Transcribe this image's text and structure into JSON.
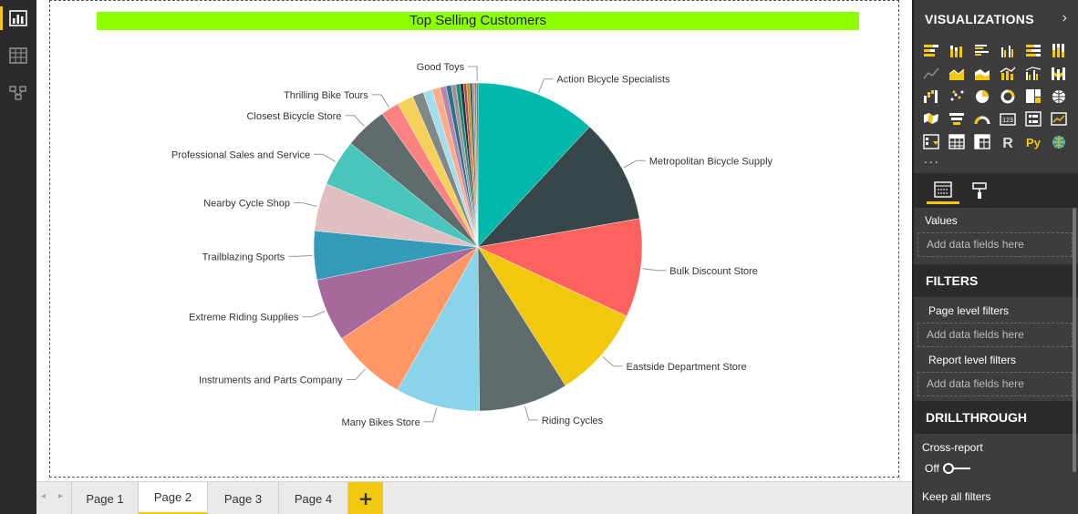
{
  "rail": {
    "items": [
      {
        "name": "report-view",
        "icon": "bar-chart-icon",
        "active": true
      },
      {
        "name": "data-view",
        "icon": "table-grid-icon",
        "active": false
      },
      {
        "name": "model-view",
        "icon": "relationships-icon",
        "active": false
      }
    ]
  },
  "visual": {
    "title": "Top Selling Customers",
    "title_bg": "#8cff00"
  },
  "chart_data": {
    "type": "pie",
    "title": "Top Selling Customers",
    "legend": "none (data labels on slices)",
    "slices": [
      {
        "label": "Action Bicycle Specialists",
        "value": 11.9,
        "color": "#01b8aa"
      },
      {
        "label": "Metropolitan Bicycle Supply",
        "value": 10.3,
        "color": "#374649"
      },
      {
        "label": "Bulk Discount Store",
        "value": 9.7,
        "color": "#fd625e"
      },
      {
        "label": "Eastside Department Store",
        "value": 9.1,
        "color": "#f2c80f"
      },
      {
        "label": "Riding Cycles",
        "value": 8.8,
        "color": "#5f6b6d"
      },
      {
        "label": "Many Bikes Store",
        "value": 8.3,
        "color": "#8ad4eb"
      },
      {
        "label": "Instruments and Parts Company",
        "value": 7.4,
        "color": "#fe9666"
      },
      {
        "label": "Extreme Riding Supplies",
        "value": 6.2,
        "color": "#a66999"
      },
      {
        "label": "Trailblazing Sports",
        "value": 4.8,
        "color": "#3599b8"
      },
      {
        "label": "Nearby Cycle Shop",
        "value": 4.7,
        "color": "#dfbfbf"
      },
      {
        "label": "Professional Sales and Service",
        "value": 4.6,
        "color": "#4ac5bb"
      },
      {
        "label": "Closest Bicycle Store",
        "value": 4.2,
        "color": "#5f6b6d"
      },
      {
        "label": "Thrilling Bike Tours",
        "value": 1.8,
        "color": "#fb8281"
      },
      {
        "label": "",
        "value": 1.6,
        "color": "#f4d25a"
      },
      {
        "label": "",
        "value": 1.1,
        "color": "#7f898a"
      },
      {
        "label": "",
        "value": 0.9,
        "color": "#a4ddee"
      },
      {
        "label": "",
        "value": 0.8,
        "color": "#fdab89"
      },
      {
        "label": "",
        "value": 0.6,
        "color": "#b687ac"
      },
      {
        "label": "",
        "value": 0.5,
        "color": "#28738a"
      },
      {
        "label": "",
        "value": 0.45,
        "color": "#a78f8f"
      },
      {
        "label": "",
        "value": 0.4,
        "color": "#168980"
      },
      {
        "label": "",
        "value": 0.35,
        "color": "#293537"
      },
      {
        "label": "",
        "value": 0.3,
        "color": "#bb4a4a"
      },
      {
        "label": "",
        "value": 0.3,
        "color": "#b59525"
      },
      {
        "label": "",
        "value": 0.25,
        "color": "#475052"
      },
      {
        "label": "",
        "value": 0.2,
        "color": "#6a9fb0"
      },
      {
        "label": "",
        "value": 0.2,
        "color": "#bd7150"
      },
      {
        "label": "Good Toys",
        "value": 0.15,
        "color": "#7b4f71"
      }
    ]
  },
  "tabs": {
    "prev_arrow": "◂",
    "next_arrow": "▸",
    "pages": [
      {
        "label": "Page 1",
        "active": false
      },
      {
        "label": "Page 2",
        "active": true
      },
      {
        "label": "Page 3",
        "active": false
      },
      {
        "label": "Page 4",
        "active": false
      }
    ],
    "add_label": "+",
    "accent": "#f2c811"
  },
  "pane": {
    "title": "VISUALIZATIONS",
    "chevron": "›",
    "viz_icons": [
      "stacked-bar-icon",
      "stacked-column-icon",
      "clustered-bar-icon",
      "clustered-column-icon",
      "100-bar-icon",
      "100-column-icon",
      "line-chart-icon",
      "area-chart-icon",
      "stacked-area-icon",
      "line-column-icon",
      "line-clustered-column-icon",
      "ribbon-chart-icon",
      "waterfall-icon",
      "scatter-icon",
      "pie-chart-icon",
      "donut-icon",
      "treemap-icon",
      "map-icon",
      "filled-map-icon",
      "funnel-icon",
      "gauge-icon",
      "card-icon",
      "multi-row-card-icon",
      "kpi-icon",
      "slicer-icon",
      "table-icon",
      "matrix-icon",
      "r-visual-icon",
      "python-visual-icon",
      "globe-icon"
    ],
    "r_glyph": "R",
    "py_glyph": "Py",
    "more": "...",
    "values_label": "Values",
    "drop_placeholder": "Add data fields here",
    "filters_head": "FILTERS",
    "page_filters": "Page level filters",
    "report_filters": "Report level filters",
    "drill_head": "DRILLTHROUGH",
    "cross_report": "Cross-report",
    "cross_state": "Off",
    "keep_filters": "Keep all filters"
  }
}
